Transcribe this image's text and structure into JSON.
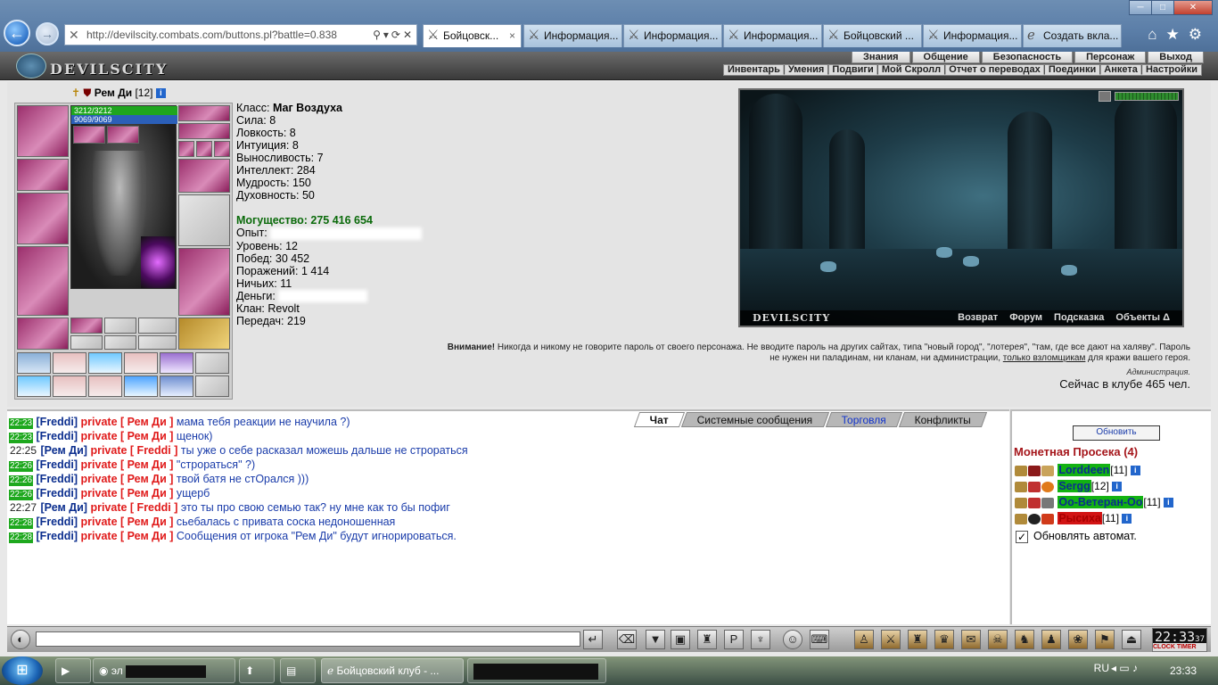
{
  "browser": {
    "address": "http://devilscity.combats.com/buttons.pl?battle=0.838",
    "tabs": [
      {
        "label": "Бойцовск...",
        "active": true
      },
      {
        "label": "Информация..."
      },
      {
        "label": "Информация..."
      },
      {
        "label": "Информация..."
      },
      {
        "label": "Бойцовский ..."
      },
      {
        "label": "Информация..."
      },
      {
        "label": "Создать вкла..."
      }
    ]
  },
  "game": {
    "logo": "DEVILSCITY",
    "top_menu": [
      "Знания",
      "Общение",
      "Безопасность",
      "Персонаж",
      "Выход"
    ],
    "sub_menu": [
      "Инвентарь",
      "Умения",
      "Подвиги",
      "Мой Скролл",
      "Отчет о переводах",
      "Поединки",
      "Анкета",
      "Настройки"
    ]
  },
  "character": {
    "name": "Рем Ди",
    "level_tag": "[12]",
    "hp": "3212/3212",
    "mp": "9069/9069",
    "class_label": "Класс:",
    "class_value": "Маг Воздуха",
    "stats": [
      "Сила: 8",
      "Ловкость: 8",
      "Интуиция: 8",
      "Выносливость: 7",
      "Интеллект: 284",
      "Мудрость: 150",
      "Духовность: 50"
    ],
    "power": "Могущество: 275 416 654",
    "exp_label": "Опыт:",
    "level": "Уровень: 12",
    "wins": "Побед: 30 452",
    "losses": "Поражений: 1 414",
    "draws": "Ничьих: 11",
    "money_label": "Деньги:",
    "clan": "Клан: Revolt",
    "transfers": "Передач: 219"
  },
  "scene": {
    "brand": "DEVILSCITY",
    "links": [
      "Возврат",
      "Форум",
      "Подсказка",
      "Объекты Δ"
    ]
  },
  "notice": {
    "bold": "Внимание!",
    "text_before": " Никогда и никому не говорите пароль от своего персонажа. Не вводите пароль на других сайтах, типа \"новый город\", \"лотерея\", \"там, где все дают на халяву\". Пароль не нужен ни паладинам, ни кланам, ни администрации, ",
    "link": "только взломщикам",
    "text_after": " для кражи вашего героя.",
    "signature": "Администрация.",
    "online": "Сейчас в клубе 465 чел."
  },
  "chat_tabs": [
    "Чат",
    "Системные сообщения",
    "Торговля",
    "Конфликты"
  ],
  "chat": [
    {
      "time": "22:23",
      "user": "[Freddi]",
      "priv": "private [ Рем Ди ]",
      "text": "мама тебя реакции не научила ?)"
    },
    {
      "time": "22:23",
      "user": "[Freddi]",
      "priv": "private [ Рем Ди ]",
      "text": "щенок)"
    },
    {
      "time": "22:25",
      "user": "[Рем Ди]",
      "priv": "private [ Freddi ]",
      "text": "ты уже о себе расказал можешь дальше не строраться",
      "plain": true
    },
    {
      "time": "22:26",
      "user": "[Freddi]",
      "priv": "private [ Рем Ди ]",
      "text": "\"строраться\" ?)"
    },
    {
      "time": "22:26",
      "user": "[Freddi]",
      "priv": "private [ Рем Ди ]",
      "text": "твой батя не стОрался )))"
    },
    {
      "time": "22:26",
      "user": "[Freddi]",
      "priv": "private [ Рем Ди ]",
      "text": "ущерб"
    },
    {
      "time": "22:27",
      "user": "[Рем Ди]",
      "priv": "private [ Freddi ]",
      "text": "это ты про свою семью так? ну мне как то бы пофиг",
      "plain": true
    },
    {
      "time": "22:28",
      "user": "[Freddi]",
      "priv": "private [ Рем Ди ]",
      "text": "сьебалась с привата соска недоношенная"
    },
    {
      "time": "22:28",
      "user": "[Freddi]",
      "priv": "private [ Рем Ди ]",
      "text": "Сообщения от игрока \"Рем Ди\" будут игнорироваться."
    }
  ],
  "side": {
    "refresh": "Обновить",
    "location": "Монетная Просека (4)",
    "players": [
      {
        "name": "Lorddeen",
        "level": "[11]",
        "color": "green"
      },
      {
        "name": "Sergg",
        "level": "[12]",
        "color": "green"
      },
      {
        "name": "Оо-Ветеран-Оо",
        "level": "[11]",
        "color": "green"
      },
      {
        "name": "Рысиха",
        "level": "[11]",
        "color": "red"
      }
    ],
    "auto_update": "Обновлять автомат.",
    "auto_update_checked": true
  },
  "clock": {
    "time": "22:33",
    "sec": "37",
    "label": "CLOCK TIMER"
  },
  "taskbar": {
    "lang": "RU",
    "time": "23:33",
    "items": [
      "",
      "эл",
      "",
      "",
      "Бойцовский клуб - ...",
      ""
    ]
  }
}
